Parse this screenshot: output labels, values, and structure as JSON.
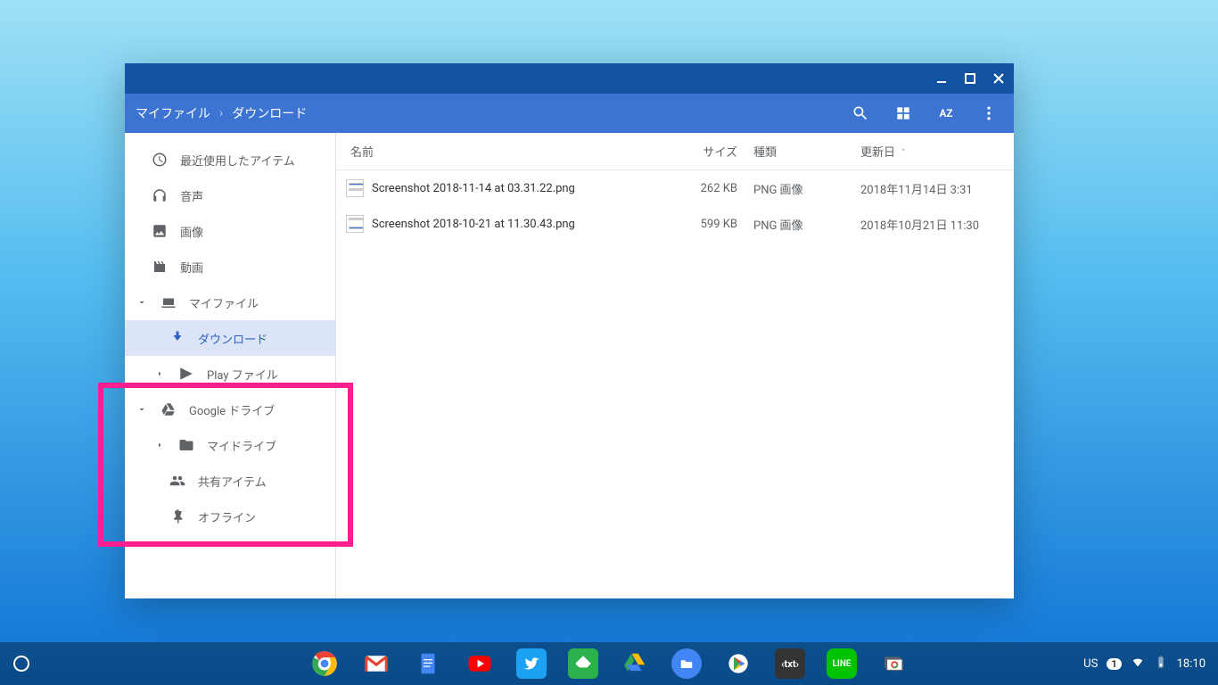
{
  "breadcrumb": {
    "root": "マイファイル",
    "current": "ダウンロード"
  },
  "columns": {
    "name": "名前",
    "size": "サイズ",
    "type": "種類",
    "date": "更新日"
  },
  "sidebar": {
    "recent": "最近使用したアイテム",
    "audio": "音声",
    "images": "画像",
    "videos": "動画",
    "myfiles": "マイファイル",
    "downloads": "ダウンロード",
    "playfiles": "Play ファイル",
    "gdrive": "Google ドライブ",
    "mydrive": "マイドライブ",
    "shared": "共有アイテム",
    "offline": "オフライン"
  },
  "files": [
    {
      "name": "Screenshot 2018-11-14 at 03.31.22.png",
      "size": "262 KB",
      "type": "PNG 画像",
      "date": "2018年11月14日 3:31"
    },
    {
      "name": "Screenshot 2018-10-21 at 11.30.43.png",
      "size": "599 KB",
      "type": "PNG 画像",
      "date": "2018年10月21日 11:30"
    }
  ],
  "tray": {
    "ime": "US",
    "notif": "1",
    "time": "18:10"
  }
}
